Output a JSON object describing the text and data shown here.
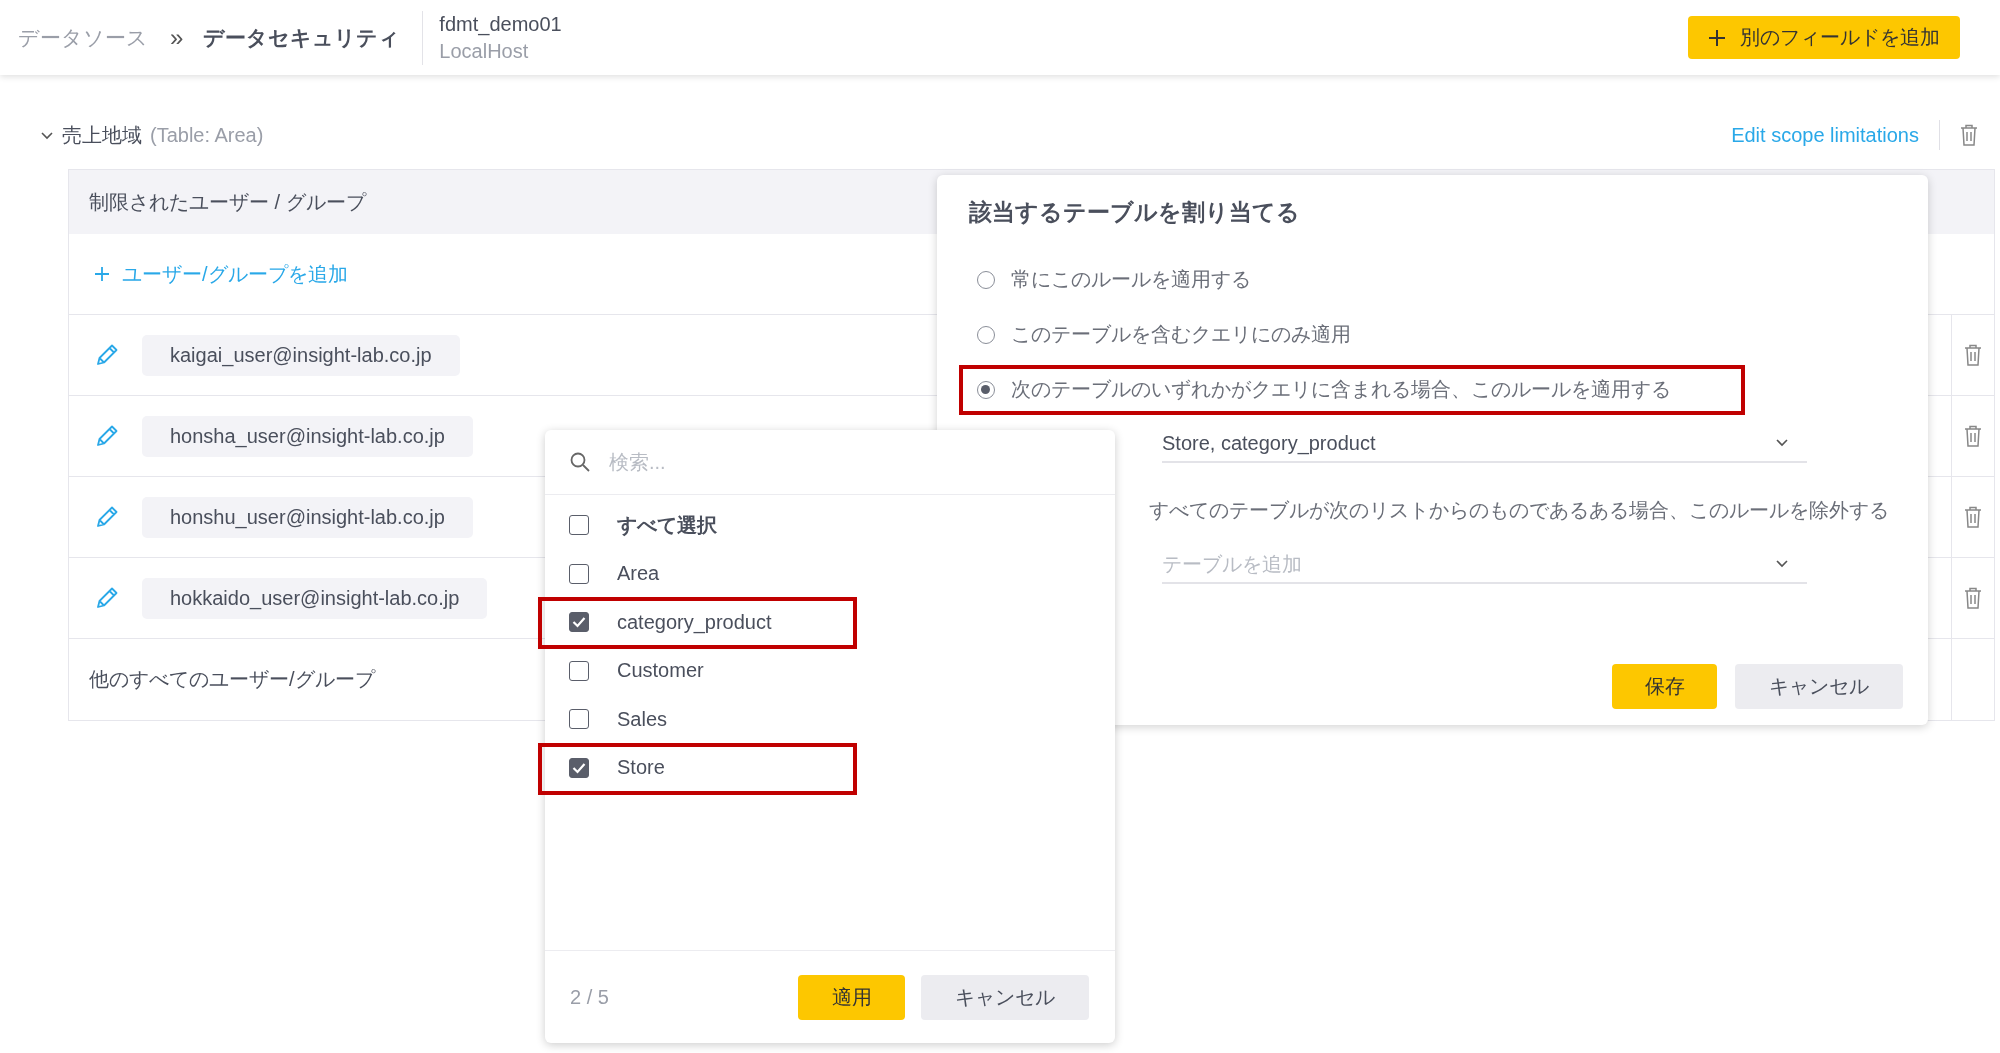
{
  "header": {
    "breadcrumb": {
      "parent": "データソース",
      "separator": "»",
      "current": "データセキュリティ"
    },
    "datasource": {
      "name": "fdmt_demo01",
      "host": "LocalHost"
    },
    "add_field_button": "別のフィールドを追加"
  },
  "section": {
    "title": "売上地域",
    "subtitle": "(Table: Area)",
    "expanded": true,
    "edit_link": "Edit scope limitations"
  },
  "table": {
    "header": "制限されたユーザー / グループ",
    "add_link": "ユーザー/グループを追加",
    "rows": [
      {
        "user": "kaigai_user@insight-lab.co.jp"
      },
      {
        "user": "honsha_user@insight-lab.co.jp"
      },
      {
        "user": "honshu_user@insight-lab.co.jp"
      },
      {
        "user": "hokkaido_user@insight-lab.co.jp"
      }
    ],
    "footer_row": "他のすべてのユーザー/グループ"
  },
  "dialog": {
    "title": "該当するテーブルを割り当てる",
    "options": [
      {
        "label": "常にこのルールを適用する",
        "selected": false,
        "highlighted": false
      },
      {
        "label": "このテーブルを含むクエリにのみ適用",
        "selected": false,
        "highlighted": false
      },
      {
        "label": "次のテーブルのいずれかがクエリに含まれる場合、このルールを適用する",
        "selected": true,
        "highlighted": true
      }
    ],
    "table_select": {
      "value": "Store, category_product"
    },
    "exclude_label": "すべてのテーブルが次のリストからのものであるある場合、このルールを除外する",
    "exclude_select": {
      "placeholder": "テーブルを追加"
    },
    "save": "保存",
    "cancel": "キャンセル"
  },
  "popup": {
    "search_placeholder": "検索...",
    "select_all": {
      "label": "すべて選択",
      "checked": false
    },
    "items": [
      {
        "label": "Area",
        "checked": false,
        "highlighted": false
      },
      {
        "label": "category_product",
        "checked": true,
        "highlighted": true
      },
      {
        "label": "Customer",
        "checked": false,
        "highlighted": false
      },
      {
        "label": "Sales",
        "checked": false,
        "highlighted": false
      },
      {
        "label": "Store",
        "checked": true,
        "highlighted": true
      }
    ],
    "count": "2 / 5",
    "apply": "適用",
    "cancel": "キャンセル"
  }
}
